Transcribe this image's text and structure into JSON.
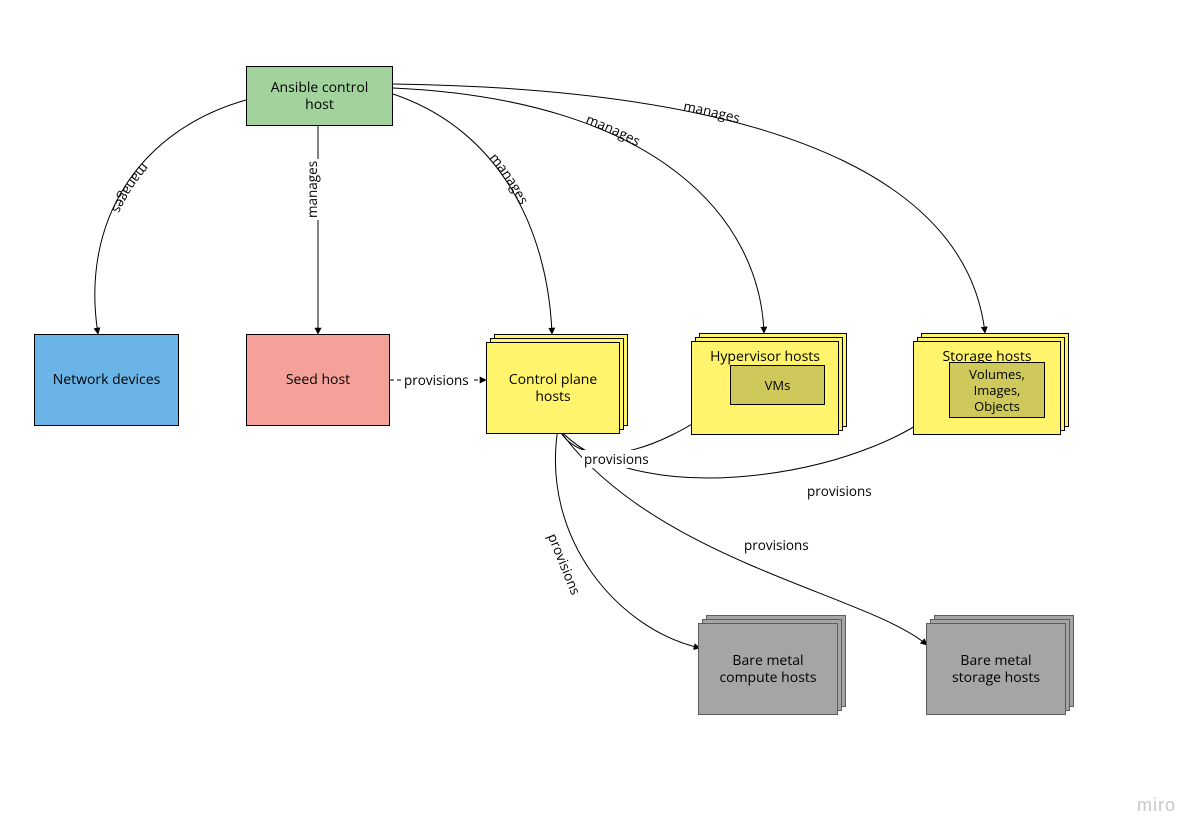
{
  "nodes": {
    "ansible": {
      "label": "Ansible control host"
    },
    "network": {
      "label": "Network devices"
    },
    "seed": {
      "label": "Seed host"
    },
    "control_plane": {
      "label": "Control plane hosts"
    },
    "hypervisor": {
      "label": "Hypervisor hosts"
    },
    "hypervisor_inner": {
      "label": "VMs"
    },
    "storage": {
      "label": "Storage hosts"
    },
    "storage_inner": {
      "label": "Volumes, Images, Objects"
    },
    "bm_compute": {
      "label": "Bare metal compute hosts"
    },
    "bm_storage": {
      "label": "Bare metal storage hosts"
    }
  },
  "edges": {
    "manages": "manages",
    "provisions": "provisions"
  },
  "watermark": "miro"
}
